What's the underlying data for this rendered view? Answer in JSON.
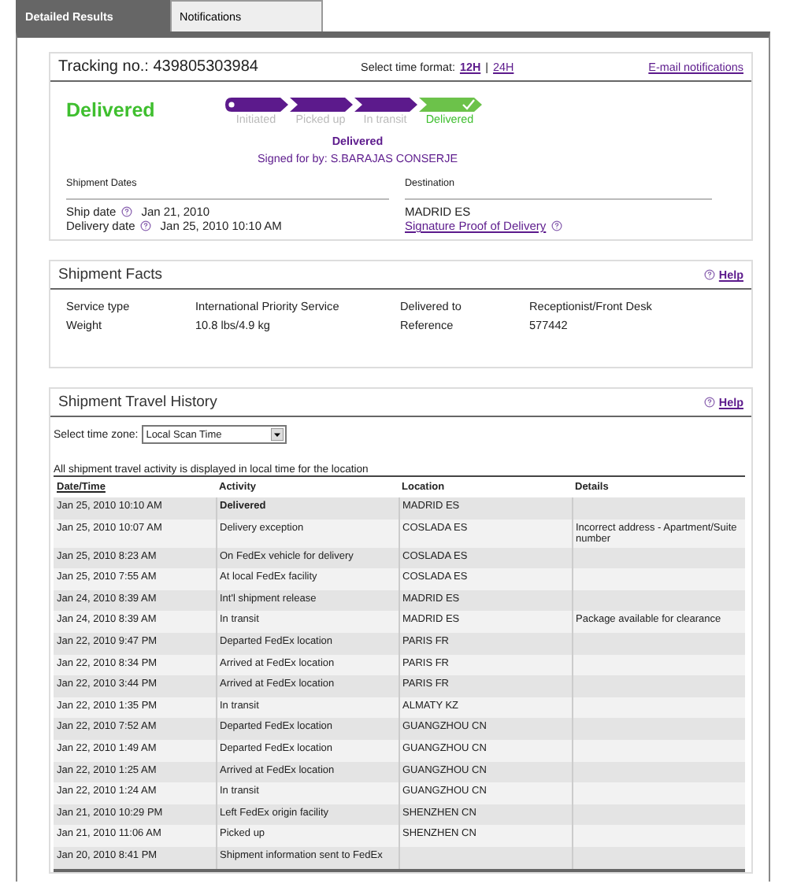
{
  "tabs": [
    {
      "label": "Detailed Results",
      "selected": true
    },
    {
      "label": "Notifications",
      "selected": false
    }
  ],
  "tracking": {
    "label": "Tracking no.:",
    "number": "439805303984",
    "time_format_label": "Select time format:",
    "time_formats": [
      {
        "label": "12H",
        "selected": true
      },
      {
        "label": "24H",
        "selected": false
      }
    ],
    "separator": "|",
    "email_link": "E-mail notifications"
  },
  "status": {
    "title": "Delivered",
    "steps": [
      {
        "label": "Initiated",
        "selected": false
      },
      {
        "label": "Picked up",
        "selected": false
      },
      {
        "label": "In transit",
        "selected": false
      },
      {
        "label": "Delivered",
        "selected": true
      }
    ],
    "summary": "Delivered",
    "signed_for": "Signed for by:  S.BARAJAS CONSERJE"
  },
  "dates": {
    "heading": "Shipment Dates",
    "ship_label": "Ship date",
    "ship_value": "Jan 21, 2010",
    "delivery_label": "Delivery date",
    "delivery_value": "Jan 25, 2010 10:10 AM"
  },
  "destination": {
    "heading": "Destination",
    "value": "MADRID ES",
    "proof_link": "Signature Proof of Delivery"
  },
  "facts": {
    "title": "Shipment Facts",
    "help": "Help",
    "items": [
      {
        "label": "Service type",
        "value": "International Priority Service"
      },
      {
        "label": "Delivered to",
        "value": "Receptionist/Front Desk"
      },
      {
        "label": "Weight",
        "value": "10.8 lbs/4.9 kg"
      },
      {
        "label": "Reference",
        "value": "577442"
      }
    ]
  },
  "history": {
    "title": "Shipment Travel History",
    "help": "Help",
    "timezone_label": "Select time zone:",
    "timezone_value": "Local Scan Time",
    "note": "All shipment travel activity is displayed in local time for the location",
    "columns": [
      "Date/Time",
      "Activity",
      "Location",
      "Details"
    ],
    "rows": [
      {
        "date": "Jan 25, 2010 10:10 AM",
        "activity": "Delivered",
        "location": "MADRID ES",
        "bold": true
      },
      {
        "date": "Jan 25, 2010 10:07 AM",
        "activity": "Delivery exception",
        "location": "COSLADA ES",
        "details": "Incorrect address - Apartment/Suite number",
        "bold": false
      },
      {
        "date": "Jan 25, 2010 8:23 AM",
        "activity": "On FedEx vehicle for delivery",
        "location": "COSLADA ES",
        "bold": false
      },
      {
        "date": "Jan 25, 2010 7:55 AM",
        "activity": "At local FedEx facility",
        "location": "COSLADA ES",
        "bold": false
      },
      {
        "date": "Jan 24, 2010 8:39 AM",
        "activity": "Int'l shipment release",
        "location": "MADRID ES",
        "bold": false
      },
      {
        "date": "Jan 24, 2010 8:39 AM",
        "activity": "In transit",
        "location": "MADRID ES",
        "details": "Package available for clearance",
        "bold": false
      },
      {
        "date": "Jan 22, 2010 9:47 PM",
        "activity": "Departed FedEx location",
        "location": "PARIS FR",
        "bold": false
      },
      {
        "date": "Jan 22, 2010 8:34 PM",
        "activity": "Arrived at FedEx location",
        "location": "PARIS FR",
        "bold": false
      },
      {
        "date": "Jan 22, 2010 3:44 PM",
        "activity": "Arrived at FedEx location",
        "location": "PARIS FR",
        "bold": false
      },
      {
        "date": "Jan 22, 2010 1:35 PM",
        "activity": "In transit",
        "location": "ALMATY KZ",
        "bold": false
      },
      {
        "date": "Jan 22, 2010 7:52 AM",
        "activity": "Departed FedEx location",
        "location": "GUANGZHOU CN",
        "bold": false
      },
      {
        "date": "Jan 22, 2010 1:49 AM",
        "activity": "Departed FedEx location",
        "location": "GUANGZHOU CN",
        "bold": false
      },
      {
        "date": "Jan 22, 2010 1:25 AM",
        "activity": "Arrived at FedEx location",
        "location": "GUANGZHOU CN",
        "bold": false
      },
      {
        "date": "Jan 22, 2010 1:24 AM",
        "activity": "In transit",
        "location": "GUANGZHOU CN",
        "bold": false
      },
      {
        "date": "Jan 21, 2010 10:29 PM",
        "activity": "Left FedEx origin facility",
        "location": "SHENZHEN CN",
        "bold": false
      },
      {
        "date": "Jan 21, 2010 11:06 AM",
        "activity": "Picked up",
        "location": "SHENZHEN CN",
        "bold": false
      },
      {
        "date": "Jan 20, 2010 8:41 PM",
        "activity": "Shipment information sent to FedEx",
        "bold": false
      }
    ]
  }
}
